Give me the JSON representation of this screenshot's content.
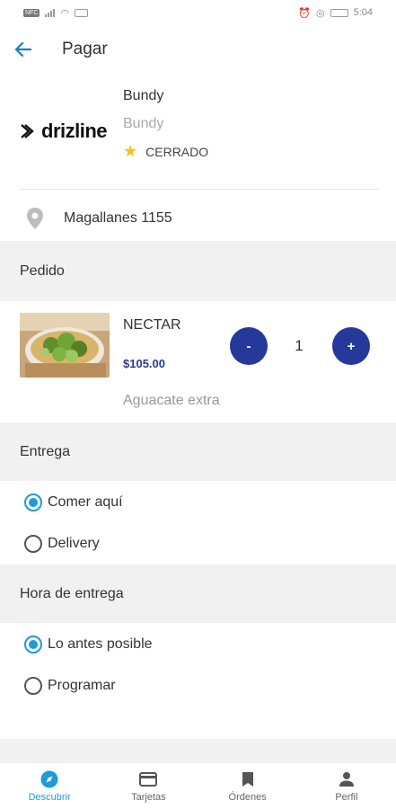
{
  "status_bar": {
    "left_badge": "NFC",
    "time": "5:04"
  },
  "header": {
    "title": "Pagar"
  },
  "store": {
    "logo_text": "drizline",
    "name": "Bundy",
    "subtitle": "Bundy",
    "status": "CERRADO"
  },
  "address": {
    "text": "Magallanes 1155"
  },
  "order": {
    "section_label": "Pedido",
    "item": {
      "name": "NECTAR",
      "price": "$105.00",
      "extra": "Aguacate extra",
      "quantity": "1",
      "minus_label": "-",
      "plus_label": "+"
    }
  },
  "delivery": {
    "section_label": "Entrega",
    "options": [
      {
        "label": "Comer aquí",
        "selected": true
      },
      {
        "label": "Delivery",
        "selected": false
      }
    ]
  },
  "delivery_time": {
    "section_label": "Hora de entrega",
    "options": [
      {
        "label": "Lo antes posible",
        "selected": true
      },
      {
        "label": "Programar",
        "selected": false
      }
    ]
  },
  "bottom_nav": {
    "items": [
      {
        "label": "Descubrir",
        "icon": "compass-icon",
        "active": true
      },
      {
        "label": "Tarjetas",
        "icon": "card-icon",
        "active": false
      },
      {
        "label": "Órdenes",
        "icon": "bookmark-icon",
        "active": false
      },
      {
        "label": "Perfil",
        "icon": "person-icon",
        "active": false
      }
    ]
  },
  "colors": {
    "accent": "#1e9ad8",
    "qty_button": "#24399a",
    "price": "#2a3c8e",
    "star": "#f2c21b"
  }
}
